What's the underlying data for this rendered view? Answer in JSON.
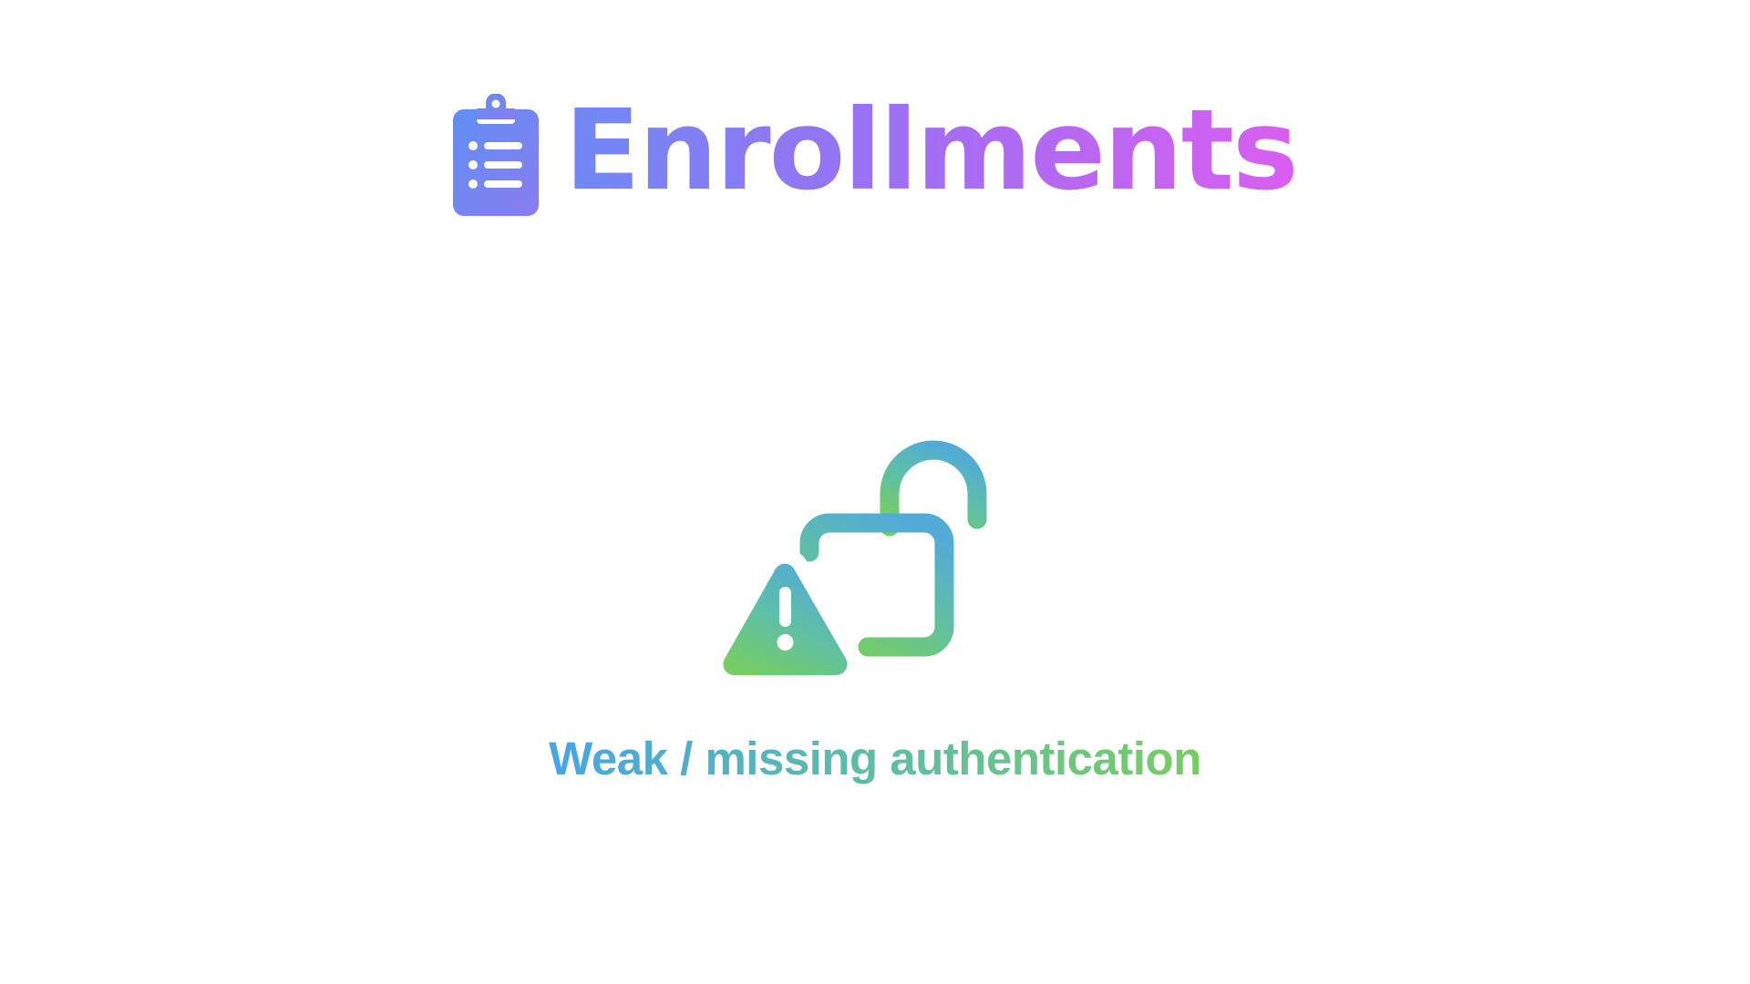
{
  "header": {
    "title": "Enrollments",
    "icon": "clipboard-list-icon",
    "gradient": [
      "#6f89f4",
      "#9d6ff2",
      "#d95ef1"
    ]
  },
  "illustration": {
    "icons": [
      "unlocked-padlock-icon",
      "warning-triangle-icon"
    ],
    "gradient": [
      "#52abd6",
      "#5fbfa6",
      "#76cd62"
    ]
  },
  "caption": {
    "text": "Weak / missing authentication",
    "gradient": [
      "#45a5e6",
      "#5bbbab",
      "#76cd62"
    ]
  }
}
